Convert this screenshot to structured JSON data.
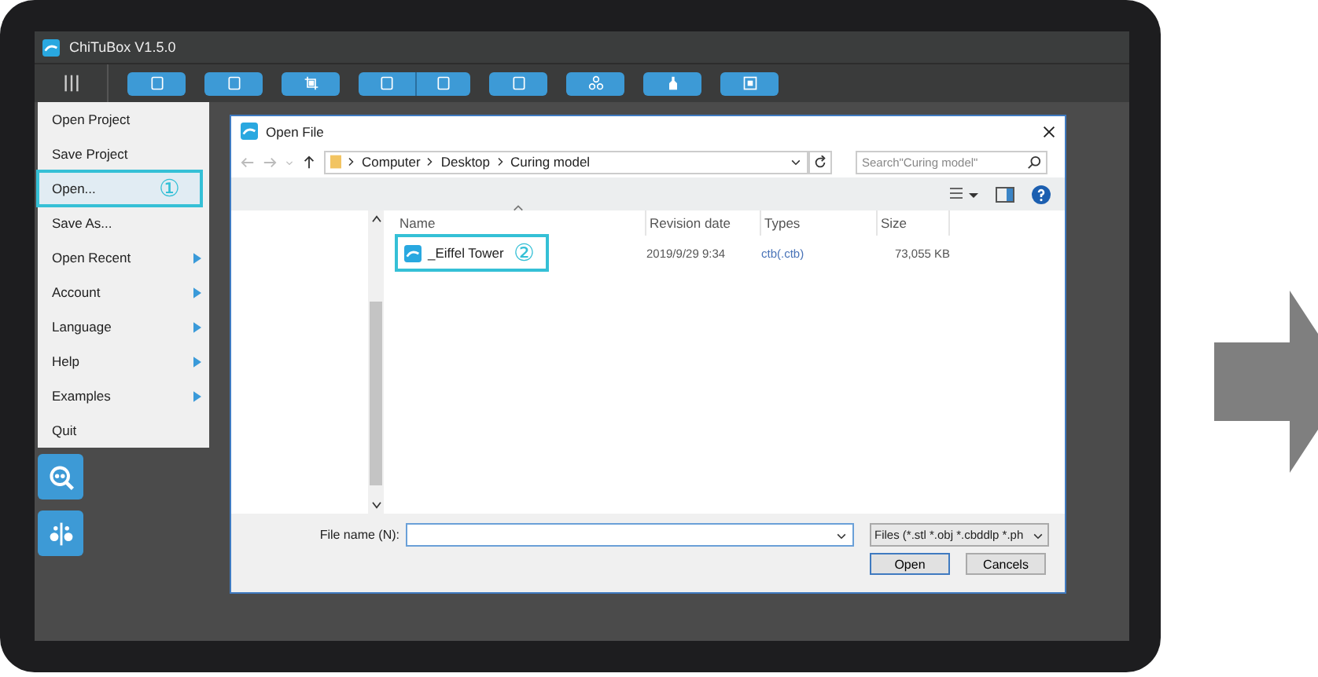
{
  "window": {
    "title": "ChiTuBox V1.5.0"
  },
  "menu": [
    {
      "label": "Open Project",
      "selected": false,
      "submenu": false
    },
    {
      "label": "Save Project",
      "selected": false,
      "submenu": false
    },
    {
      "label": "Open...",
      "selected": true,
      "submenu": false,
      "callout": "①"
    },
    {
      "label": "Save As...",
      "selected": false,
      "submenu": false
    },
    {
      "label": "Open Recent",
      "selected": false,
      "submenu": true
    },
    {
      "label": "Account",
      "selected": false,
      "submenu": true
    },
    {
      "label": "Language",
      "selected": false,
      "submenu": true
    },
    {
      "label": "Help",
      "selected": false,
      "submenu": true
    },
    {
      "label": "Examples",
      "selected": false,
      "submenu": true
    },
    {
      "label": "Quit",
      "selected": false,
      "submenu": false
    }
  ],
  "dialog": {
    "title": "Open File",
    "path": [
      "Computer",
      "Desktop",
      "Curing model"
    ],
    "search": {
      "placeholder": "Search\"Curing model\""
    },
    "columns": [
      "Name",
      "Revision date",
      "Types",
      "Size"
    ],
    "rows": [
      {
        "name": "_Eiffel Tower",
        "date": "2019/9/29 9:34",
        "type": "ctb(.ctb)",
        "size": "73,055 KB",
        "selected": true,
        "callout": "②"
      }
    ],
    "file_name_label": "File name (N):",
    "file_type": "Files (*.stl *.obj *.cbddlp *.ph",
    "buttons": [
      "Open",
      "Cancels"
    ]
  }
}
